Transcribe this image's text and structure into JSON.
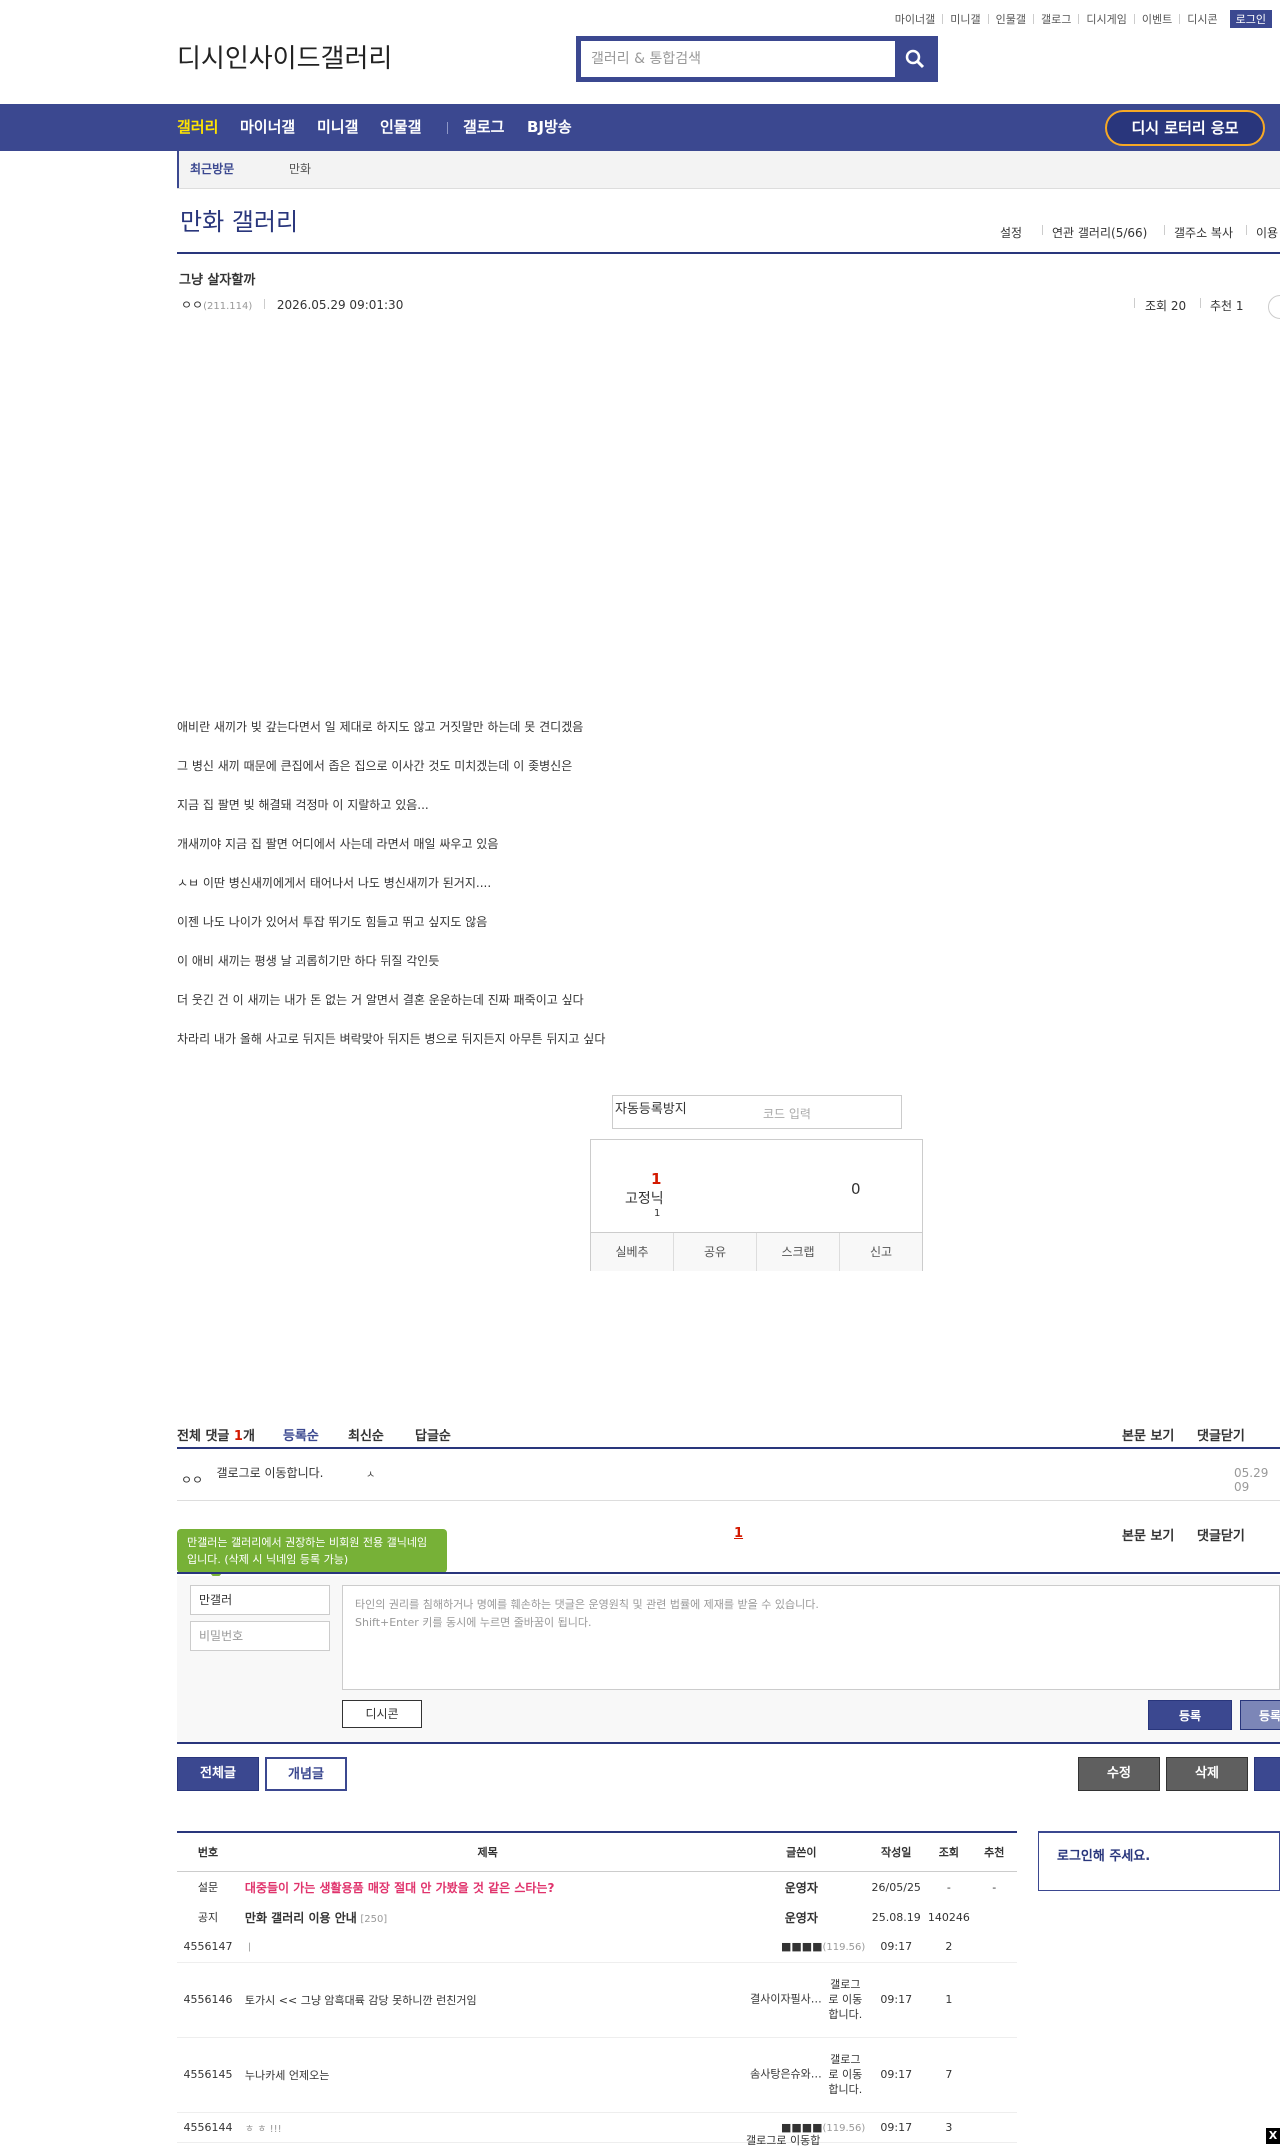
{
  "top_links": [
    "마이너갤",
    "미니갤",
    "인물갤",
    "갤로그",
    "디시게임",
    "이벤트",
    "디시콘"
  ],
  "login_label": "로그인",
  "logo_alt": "디시인사이드갤러리",
  "search_placeholder": "갤러리 & 통합검색",
  "nav": {
    "items": [
      "갤러리",
      "마이너갤",
      "미니갤",
      "인물갤",
      "갤로그",
      "BJ방송"
    ],
    "lottery": "디시 로터리 응모"
  },
  "recent": {
    "label": "최근방문",
    "item": "만화"
  },
  "gallery": {
    "title": "만화 갤러리",
    "menu": [
      "설정",
      "연관 갤러리(5/66)",
      "갤주소 복사",
      "이용"
    ]
  },
  "post": {
    "title": "그냥 살자할까",
    "writer": "ㅇㅇ",
    "ip": "(211.114)",
    "date": "2026.05.29 09:01:30",
    "views_label": "조회 20",
    "recommend_label": "추천 1",
    "lines": [
      "애비란 새끼가 빚 갚는다면서 일 제대로 하지도 않고 거짓말만 하는데 못 견디겠음",
      "그 병신 새끼 때문에 큰집에서 좁은 집으로 이사간 것도 미치겠는데 이 좆병신은",
      "지금 집 팔면 빚 해결돼 걱정마 이 지랄하고 있음...",
      "개새끼야 지금 집 팔면 어디에서 사는데 라면서 매일 싸우고 있음",
      "ㅅㅂ 이딴 병신새끼에게서 태어나서 나도 병신새끼가 된거지....",
      "이젠 나도 나이가 있어서 투잡 뛰기도 힘들고 뛰고 싶지도 않음",
      "이 애비 새끼는 평생 날 괴롭히기만 하다 뒤질 각인듯",
      "더 웃긴 건 이 새끼는 내가 돈 없는 거 알면서 결혼 운운하는데 진짜 패죽이고 싶다",
      "차라리 내가 올해 사고로 뒤지든 벼락맞아 뒤지든 병으로 뒤지든지 아무튼 뒤지고 싶다"
    ]
  },
  "captcha": {
    "img_alt": "자동등록방지",
    "placeholder": "코드 입력"
  },
  "vote": {
    "up": "1",
    "fixed_alt": "고정닉",
    "fixed_count": "1",
    "down": "0",
    "buttons": [
      "실베추",
      "공유",
      "스크랩",
      "신고"
    ]
  },
  "comments": {
    "label": "전체 댓글",
    "count": "1",
    "unit": "개",
    "sorts": [
      "등록순",
      "최신순",
      "답글순"
    ],
    "right": [
      "본문 보기",
      "댓글닫기"
    ],
    "item": {
      "writer": "ㅇㅇ",
      "img_alt": "갤로그로 이동합니다.",
      "img2_alt": "ㅅ",
      "date": "05.29 09"
    },
    "page": "1",
    "tooltip": "만갤러는 갤러리에서 권장하는 비회원 전용 갤닉네임입니다. (삭제 시 닉네임 등록 가능)",
    "nick": "만갤러",
    "password_placeholder": "비밀번호",
    "textarea_line1": "타인의 권리를 침해하거나 명예를 훼손하는 댓글은 운영원칙 및 관련 법률에 제재를 받을 수 있습니다.",
    "textarea_line2": "Shift+Enter 키를 동시에 누르면 줄바꿈이 됩니다.",
    "dccon": "디시콘",
    "submit": "등록",
    "submit2": "등록"
  },
  "board_buttons": {
    "all": "전체글",
    "concept": "개념글",
    "edit": "수정",
    "delete": "삭제"
  },
  "list": {
    "headers": [
      "번호",
      "제목",
      "글쓴이",
      "작성일",
      "조회",
      "추천"
    ],
    "rows": [
      {
        "no": "설문",
        "title": "대중들이 가는 생활용품 매장 절대 안 가봤을 것 같은 스타는?",
        "writer": "운영자",
        "date": "26/05/25",
        "views": "-",
        "rec": "-"
      },
      {
        "no": "공지",
        "title": "만화 갤러리 이용 안내",
        "reply": "[250]",
        "writer": "운영자",
        "date": "25.08.19",
        "views": "140246",
        "rec": ""
      },
      {
        "no": "4556147",
        "title": "ㅣ",
        "writer": "■■■■",
        "ip": "(119.56)",
        "date": "09:17",
        "views": "2",
        "rec": ""
      },
      {
        "no": "4556146",
        "title": "토가시 << 그냥 암흑대륙 감당 못하니깐 런친거임",
        "writer": "결사이자필사…",
        "icon": "갤로그로 이동합니다.",
        "date": "09:17",
        "views": "1",
        "rec": ""
      },
      {
        "no": "4556145",
        "title": "누나카세 언제오는",
        "writer": "솜사탕은슈와…",
        "icon": "갤로그로 이동합니다.",
        "date": "09:17",
        "views": "7",
        "rec": ""
      },
      {
        "no": "4556144",
        "title": "ㅎ ㅎ !!!",
        "writer": "■■■■",
        "ip": "(119.56)",
        "date": "09:17",
        "views": "3",
        "rec": ""
      }
    ],
    "last_icon": "갤로그로 이동합"
  },
  "login_box": {
    "title": "로그인해 주세요."
  },
  "close_label": "X"
}
